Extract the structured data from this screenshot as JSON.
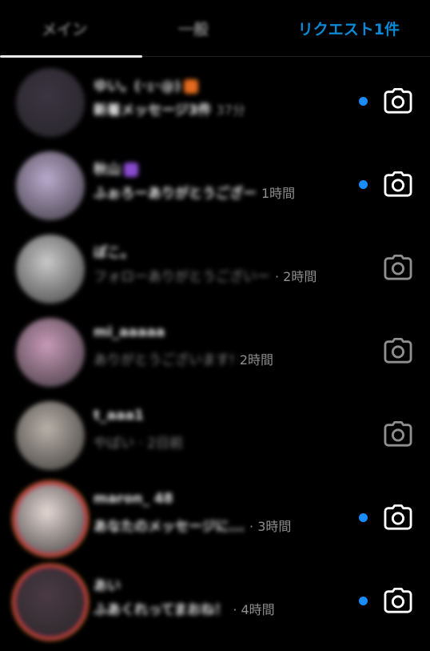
{
  "tabs": [
    {
      "label": "メイン",
      "selected": true
    },
    {
      "label": "一般",
      "selected": false
    },
    {
      "label": "リクエスト1件",
      "selected": false
    }
  ],
  "conversations": [
    {
      "name": "ゆい。(･ｪ･@)",
      "message": "新着メッセージ3件",
      "time": "37分",
      "unread": true,
      "message_style": "bold",
      "time_blurred": true,
      "avatar_color": "#3b3442",
      "badge_color": "#e36a1f",
      "ring": false
    },
    {
      "name": "秋山",
      "message": "ふぉろーありがとうござー",
      "time": "1時間",
      "unread": true,
      "message_style": "bold",
      "time_blurred": false,
      "avatar_color": "#b9a9cc",
      "badge_color": "#8a4bd0",
      "ring": false
    },
    {
      "name": "ぽこ。",
      "message": "フォローありがとうございー",
      "time": "· 2時間",
      "unread": false,
      "message_style": "dim",
      "time_blurred": false,
      "avatar_color": "#c9c9c9",
      "badge_color": "",
      "ring": false
    },
    {
      "name": "mi_aaaaa",
      "message": "ありがとうございます!",
      "time": "2時間",
      "unread": false,
      "message_style": "dim",
      "time_blurred": false,
      "avatar_color": "#c79ab8",
      "badge_color": "",
      "ring": false
    },
    {
      "name": "t_aaa1",
      "message": "やばい · 2日前",
      "time": "",
      "unread": false,
      "message_style": "dim",
      "time_blurred": false,
      "avatar_color": "#b8b0a8",
      "badge_color": "",
      "ring": false
    },
    {
      "name": "maron_ 48",
      "message": "あなたのメッセージに...",
      "time": "· 3時間",
      "unread": true,
      "message_style": "bold",
      "time_blurred": false,
      "avatar_color": "#e3d6d2",
      "badge_color": "",
      "ring": true
    },
    {
      "name": "あい",
      "message": "ふあくれってまおね！",
      "time": "· 4時間",
      "unread": true,
      "message_style": "bold",
      "time_blurred": false,
      "avatar_color": "#4a3a44",
      "badge_color": "",
      "ring": true
    }
  ],
  "colors": {
    "accent": "#0a8ad6",
    "unread_dot": "#1a8cff",
    "background": "#000000"
  },
  "icons": {
    "camera": "camera-icon"
  }
}
